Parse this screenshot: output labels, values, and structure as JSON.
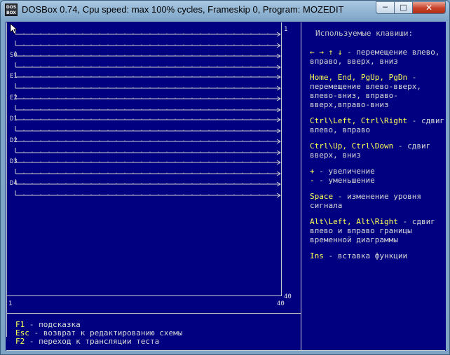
{
  "window": {
    "title": "DOSBox 0.74, Cpu speed: max 100% cycles, Frameskip  0, Program:  MOZEDIT",
    "icon_text": [
      "DOS",
      "BOX"
    ],
    "controls": {
      "minimize": "─",
      "maximize": "□",
      "close": "✕"
    }
  },
  "diagram": {
    "top_right_label": "1",
    "bottom_right_label": "40",
    "axis_start": "1",
    "axis_end": "40",
    "signals": [
      {
        "label": "",
        "arrows": 2
      },
      {
        "label": "S0",
        "arrows": 2
      },
      {
        "label": "E1",
        "arrows": 2
      },
      {
        "label": "E2",
        "arrows": 2
      },
      {
        "label": "D1",
        "arrows": 2
      },
      {
        "label": "D2",
        "arrows": 2
      },
      {
        "label": "D3",
        "arrows": 2
      },
      {
        "label": "D4",
        "arrows": 2
      }
    ]
  },
  "help": {
    "title": "Используемые клавиши:",
    "entries": [
      {
        "keys": "← → ↑ ↓",
        "desc": " - перемещение влево, вправо, вверх, вниз"
      },
      {
        "keys": "Home, End, PgUp, PgDn",
        "desc": " - перемещение влево-вверх, влево-вниз, вправо-вверх,вправо-вниз"
      },
      {
        "keys": "Ctrl\\Left, Ctrl\\Right",
        "desc": " - сдвиг влево, вправо"
      },
      {
        "keys": "Ctrl\\Up, Ctrl\\Down",
        "desc": " - сдвиг вверх, вниз"
      },
      {
        "keys": "+",
        "desc": " - увеличение"
      },
      {
        "keys": "-",
        "desc": " - уменьшение"
      },
      {
        "keys": "Space",
        "desc": " - изменение уровня сигнала"
      },
      {
        "keys": "Alt\\Left, Alt\\Right",
        "desc": " - сдвиг влево и вправо границы временной диаграммы"
      },
      {
        "keys": "Ins",
        "desc": " - вставка функции"
      }
    ]
  },
  "footer": [
    {
      "key": "F1",
      "desc": " - подсказка"
    },
    {
      "key": "Esc",
      "desc": " - возврат к редактированию схемы"
    },
    {
      "key": "F2",
      "desc": " - переход к трансляции теста"
    }
  ]
}
